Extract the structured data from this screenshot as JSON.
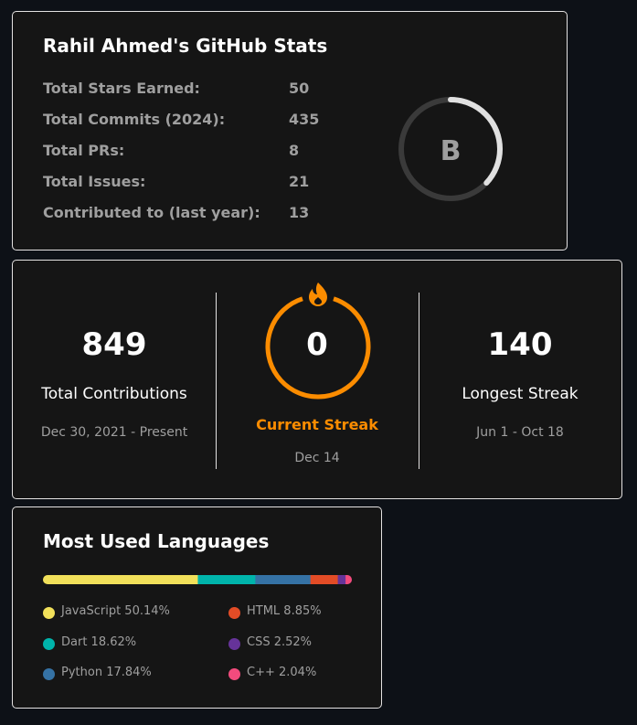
{
  "stats": {
    "title": "Rahil Ahmed's GitHub Stats",
    "rows": [
      {
        "label": "Total Stars Earned:",
        "value": "50"
      },
      {
        "label": "Total Commits (2024):",
        "value": "435"
      },
      {
        "label": "Total PRs:",
        "value": "8"
      },
      {
        "label": "Total Issues:",
        "value": "21"
      },
      {
        "label": "Contributed to (last year):",
        "value": "13"
      }
    ],
    "rank": {
      "letter": "B",
      "progress_fraction": 0.37
    },
    "colors": {
      "ring_track": "#3a3a3a",
      "ring_fill": "#e0e0e0",
      "rank_text": "#9f9f9f"
    }
  },
  "streak": {
    "total": {
      "value": "849",
      "label": "Total Contributions",
      "range": "Dec 30, 2021 - Present"
    },
    "current": {
      "value": "0",
      "label": "Current Streak",
      "date": "Dec 14"
    },
    "longest": {
      "value": "140",
      "label": "Longest Streak",
      "range": "Jun 1 - Oct 18"
    },
    "colors": {
      "ring": "#fb8c00",
      "fire": "#fb8c00"
    },
    "icon": "fire-icon"
  },
  "languages": {
    "title": "Most Used Languages",
    "items": [
      {
        "name": "JavaScript",
        "percent": 50.14,
        "label": "JavaScript 50.14%",
        "color": "#f1e05a"
      },
      {
        "name": "Dart",
        "percent": 18.62,
        "label": "Dart 18.62%",
        "color": "#00b4ab"
      },
      {
        "name": "Python",
        "percent": 17.84,
        "label": "Python 17.84%",
        "color": "#3572a5"
      },
      {
        "name": "HTML",
        "percent": 8.85,
        "label": "HTML 8.85%",
        "color": "#e34c26"
      },
      {
        "name": "CSS",
        "percent": 2.52,
        "label": "CSS 2.52%",
        "color": "#663399"
      },
      {
        "name": "C++",
        "percent": 2.04,
        "label": "C++ 2.04%",
        "color": "#f34b7d"
      }
    ]
  }
}
